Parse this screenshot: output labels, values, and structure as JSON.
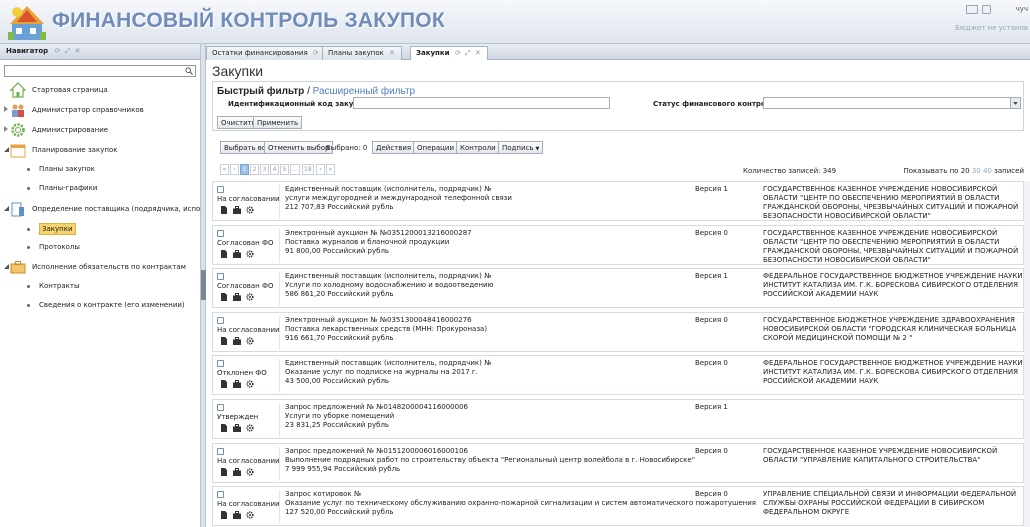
{
  "header": {
    "title": "ФИНАНСОВЫЙ КОНТРОЛЬ ЗАКУПОК",
    "user_name": "чуч",
    "user_status": "Бюджет не установ"
  },
  "navigator": {
    "tab_label": "Навигатор",
    "search_placeholder": "",
    "items": [
      {
        "label": "Стартовая страница",
        "icon": "house-icon"
      },
      {
        "label": "Администратор справочников",
        "icon": "people-icon"
      },
      {
        "label": "Администрирование",
        "icon": "gear-icon"
      },
      {
        "label": "Планирование закупок",
        "icon": "calendar-icon"
      },
      {
        "label": "Определение поставщика (подрядчика, исполнителя)",
        "icon": "building-icon"
      },
      {
        "label": "Исполнение обязательств по контрактам",
        "icon": "briefcase-icon"
      }
    ],
    "sub_planning": [
      "Планы закупок",
      "Планы-графики"
    ],
    "sub_supplier": [
      "Закупки",
      "Протоколы"
    ],
    "sub_contracts": [
      "Контракты",
      "Сведения о контракте (его изменении)"
    ]
  },
  "tabs": [
    "Остатки финансирования",
    "Планы закупок",
    "Закупки"
  ],
  "page": {
    "title": "Закупки",
    "filter_quick": "Быстрый фильтр",
    "filter_sep": " / ",
    "filter_advanced": "Расширенный фильтр",
    "id_label": "Идентификационный код закупки",
    "id_value": "",
    "status_label": "Статус финансового контроля",
    "status_value": "",
    "clear_btn": "Очистить",
    "apply_btn": "Применить",
    "select_all_btn": "Выбрать все",
    "deselect_btn": "Отменить выбор",
    "selected_text": "Выбрано: 0",
    "actions_btn": "Действия",
    "operations_btn": "Операции",
    "controls_btn": "Контроли",
    "sign_btn": "Подпись",
    "records_count": "Количество записей: 349",
    "per_page_label": "Показывать по",
    "per_page_options": [
      "20",
      "30",
      "40"
    ],
    "per_page_suffix": "записей"
  },
  "pager": {
    "first": "«",
    "prev": "‹",
    "pages": [
      "1",
      "2",
      "3",
      "4",
      "5",
      "...",
      "18"
    ],
    "next": "›",
    "last": "»"
  },
  "records": [
    {
      "status": "На согласовании",
      "line1": "Единственный поставщик (исполнитель, подрядчик) №",
      "line2": "услуги междугородней и международной телефонной связи",
      "line3": "212 707,83 Российский рубль",
      "version": "Версия 1",
      "org": "ГОСУДАРСТВЕННОЕ КАЗЕННОЕ УЧРЕЖДЕНИЕ НОВОСИБИРСКОЙ ОБЛАСТИ \"ЦЕНТР ПО ОБЕСПЕЧЕНИЮ МЕРОПРИЯТИЙ В ОБЛАСТИ ГРАЖДАНСКОЙ ОБОРОНЫ, ЧРЕЗВЫЧАЙНЫХ СИТУАЦИЙ И ПОЖАРНОЙ БЕЗОПАСНОСТИ НОВОСИБИРСКОЙ ОБЛАСТИ\""
    },
    {
      "status": "Согласован ФО",
      "line1": "Электронный аукцион № №0351200013216000287",
      "line2": "Поставка журналов и бланочной продукции",
      "line3": "91 800,00 Российский рубль",
      "version": "Версия 0",
      "org": "ГОСУДАРСТВЕННОЕ КАЗЕННОЕ УЧРЕЖДЕНИЕ НОВОСИБИРСКОЙ ОБЛАСТИ \"ЦЕНТР ПО ОБЕСПЕЧЕНИЮ МЕРОПРИЯТИЙ В ОБЛАСТИ ГРАЖДАНСКОЙ ОБОРОНЫ, ЧРЕЗВЫЧАЙНЫХ СИТУАЦИЙ И ПОЖАРНОЙ БЕЗОПАСНОСТИ НОВОСИБИРСКОЙ ОБЛАСТИ\""
    },
    {
      "status": "Согласован ФО",
      "line1": "Единственный поставщик (исполнитель, подрядчик) №",
      "line2": "Услуги по холодному водоснабжению и водоотведению",
      "line3": "586 861,20 Российский рубль",
      "version": "Версия 1",
      "org": "ФЕДЕРАЛЬНОЕ ГОСУДАРСТВЕННОЕ БЮДЖЕТНОЕ УЧРЕЖДЕНИЕ НАУКИ ИНСТИТУТ КАТАЛИЗА ИМ. Г.К. БОРЕСКОВА СИБИРСКОГО ОТДЕЛЕНИЯ РОССИЙСКОЙ АКАДЕМИИ НАУК"
    },
    {
      "status": "На согласовании",
      "line1": "Электронный аукцион № №0351300048416000276",
      "line2": "Поставка лекарственных средств (МНН: Прокуроназа)",
      "line3": "916 661,70 Российский рубль",
      "version": "Версия 0",
      "org": "ГОСУДАРСТВЕННОЕ БЮДЖЕТНОЕ УЧРЕЖДЕНИЕ ЗДРАВООХРАНЕНИЯ НОВОСИБИРСКОЙ ОБЛАСТИ \"ГОРОДСКАЯ КЛИНИЧЕСКАЯ БОЛЬНИЦА СКОРОЙ МЕДИЦИНСКОЙ ПОМОЩИ № 2 \""
    },
    {
      "status": "Отклонен ФО",
      "line1": "Единственный поставщик (исполнитель, подрядчик) №",
      "line2": "Оказание услуг по подписке на журналы на 2017 г.",
      "line3": "43 500,00 Российский рубль",
      "version": "Версия 0",
      "org": "ФЕДЕРАЛЬНОЕ ГОСУДАРСТВЕННОЕ БЮДЖЕТНОЕ УЧРЕЖДЕНИЕ НАУКИ ИНСТИТУТ КАТАЛИЗА ИМ. Г.К. БОРЕСКОВА СИБИРСКОГО ОТДЕЛЕНИЯ РОССИЙСКОЙ АКАДЕМИИ НАУК"
    },
    {
      "status": "Утвержден",
      "line1": "Запрос предложений № №0148200004116000006",
      "line2": "Услуги по уборке помещений",
      "line3": "23 831,25 Российский рубль",
      "version": "Версия 1",
      "org": ""
    },
    {
      "status": "На согласовании",
      "line1": "Запрос предложений № №0151200006016000106",
      "line2": "Выполнение подрядных работ по строительству объекта \"Региональный центр волейбола в г. Новосибирске\"",
      "line3": "7 999 955,94 Российский рубль",
      "version": "Версия 0",
      "org": "ГОСУДАРСТВЕННОЕ КАЗЕННОЕ УЧРЕЖДЕНИЕ НОВОСИБИРСКОЙ ОБЛАСТИ \"УПРАВЛЕНИЕ КАПИТАЛЬНОГО СТРОИТЕЛЬСТВА\""
    },
    {
      "status": "На согласовании",
      "line1": "Запрос котировок №",
      "line2": "Оказание услуг по техническому обслуживанию охранно-пожарной сигнализации и систем автоматического пожаротушения",
      "line3": "127 520,00 Российский рубль",
      "version": "Версия 0",
      "org": "УПРАВЛЕНИЕ СПЕЦИАЛЬНОЙ СВЯЗИ И ИНФОРМАЦИИ ФЕДЕРАЛЬНОЙ СЛУЖБЫ ОХРАНЫ РОССИЙСКОЙ ФЕДЕРАЦИИ В СИБИРСКОМ ФЕДЕРАЛЬНОМ ОКРУГЕ"
    }
  ]
}
